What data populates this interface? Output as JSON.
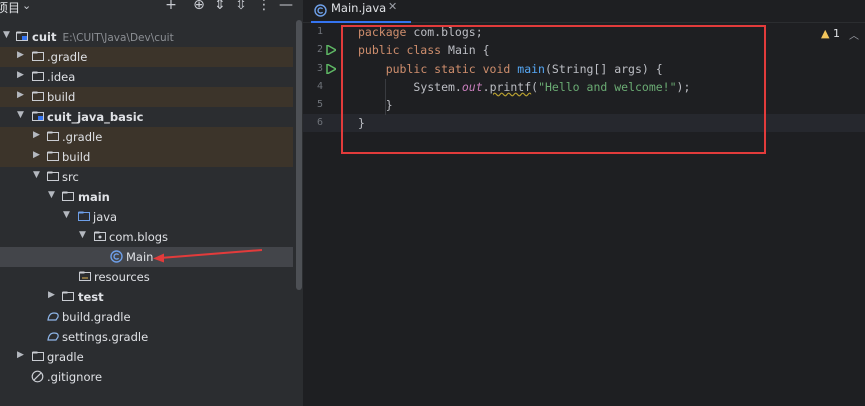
{
  "project_panel": {
    "title": "项目",
    "tree": [
      {
        "label": "cuit",
        "path": "E:\\CUIT\\Java\\Dev\\cuit",
        "bold": true
      },
      {
        "label": ".gradle"
      },
      {
        "label": ".idea"
      },
      {
        "label": "build"
      },
      {
        "label": "cuit_java_basic",
        "bold": true
      },
      {
        "label": ".gradle"
      },
      {
        "label": "build"
      },
      {
        "label": "src"
      },
      {
        "label": "main",
        "bold": true
      },
      {
        "label": "java"
      },
      {
        "label": "com.blogs"
      },
      {
        "label": "Main"
      },
      {
        "label": "resources"
      },
      {
        "label": "test",
        "bold": true
      },
      {
        "label": "build.gradle"
      },
      {
        "label": "settings.gradle"
      },
      {
        "label": "gradle"
      },
      {
        "label": ".gitignore"
      }
    ]
  },
  "editor": {
    "tab": {
      "label": "Main.java"
    },
    "warnings": {
      "count": "1"
    },
    "line_numbers": [
      "1",
      "2",
      "3",
      "4",
      "5",
      "6"
    ],
    "code": {
      "l1_kw": "package",
      "l1_rest": " com.blogs;",
      "l2_kw": "public class",
      "l2_rest": " Main {",
      "l3_kw1": "public static void",
      "l3_fn": "main",
      "l3_rest": "(String[] args) {",
      "l4_obj": "System.",
      "l4_field": "out",
      "l4_dot": ".",
      "l4_method": "printf",
      "l4_open": "(",
      "l4_str": "\"Hello and welcome!\"",
      "l4_close": ");",
      "l5": "}",
      "l6": "}"
    }
  },
  "colors": {
    "accent": "#3574f0",
    "highlight_box": "#e23b3b",
    "keyword": "#cf8e6d",
    "string": "#6aab73"
  }
}
